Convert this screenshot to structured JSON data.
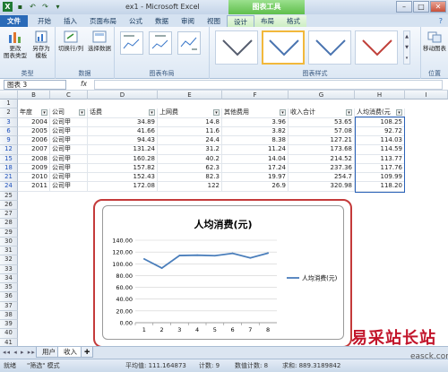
{
  "titlebar": {
    "title": "ex1 - Microsoft Excel",
    "context_group": "图表工具"
  },
  "tabs": [
    "文件",
    "开始",
    "插入",
    "页面布局",
    "公式",
    "数据",
    "审阅",
    "视图",
    "设计",
    "布局",
    "格式"
  ],
  "ribbon": {
    "groups": {
      "type": "类型",
      "data": "数据",
      "layouts": "图表布局",
      "styles": "图表样式",
      "location": "位置"
    },
    "buttons": {
      "change_type": "更改\n图表类型",
      "save_template": "另存为\n模板",
      "switch_rowcol": "切换行/列",
      "select_data": "选择数据",
      "move_chart": "移动图表"
    },
    "style_colors": [
      "#555d6e",
      "#4a74b0",
      "#4a74b0",
      "#c0403a",
      "#999999"
    ]
  },
  "formula_bar": {
    "name_box": "图表 3",
    "fx": "fx"
  },
  "columns": [
    "B",
    "C",
    "D",
    "E",
    "F",
    "G",
    "H",
    "I"
  ],
  "row_numbers": [
    "1",
    "2",
    "3",
    "6",
    "9",
    "12",
    "15",
    "18",
    "21",
    "24",
    "25",
    "26",
    "27",
    "28",
    "29",
    "30",
    "31",
    "32",
    "33",
    "34",
    "35",
    "36",
    "37",
    "38",
    "39",
    "40",
    "41"
  ],
  "headers": [
    "年度",
    "公司",
    "话费",
    "上网费",
    "其他费用",
    "收入合计",
    "人均消费(元"
  ],
  "rows": [
    {
      "year": "2004",
      "company": "公司甲",
      "phone": "34.89",
      "internet": "14.8",
      "other": "3.96",
      "income": "53.65",
      "per_capita": "108.25"
    },
    {
      "year": "2005",
      "company": "公司甲",
      "phone": "41.66",
      "internet": "11.6",
      "other": "3.82",
      "income": "57.08",
      "per_capita": "92.72"
    },
    {
      "year": "2006",
      "company": "公司甲",
      "phone": "94.43",
      "internet": "24.4",
      "other": "8.38",
      "income": "127.21",
      "per_capita": "114.03"
    },
    {
      "year": "2007",
      "company": "公司甲",
      "phone": "131.24",
      "internet": "31.2",
      "other": "11.24",
      "income": "173.68",
      "per_capita": "114.59"
    },
    {
      "year": "2008",
      "company": "公司甲",
      "phone": "160.28",
      "internet": "40.2",
      "other": "14.04",
      "income": "214.52",
      "per_capita": "113.77"
    },
    {
      "year": "2009",
      "company": "公司甲",
      "phone": "157.82",
      "internet": "62.3",
      "other": "17.24",
      "income": "237.36",
      "per_capita": "117.76"
    },
    {
      "year": "2010",
      "company": "公司甲",
      "phone": "152.43",
      "internet": "82.3",
      "other": "19.97",
      "income": "254.7",
      "per_capita": "109.99"
    },
    {
      "year": "2011",
      "company": "公司甲",
      "phone": "172.08",
      "internet": "122",
      "other": "26.9",
      "income": "320.98",
      "per_capita": "118.20"
    }
  ],
  "chart_data": {
    "type": "line",
    "title": "人均消费(元)",
    "categories": [
      "1",
      "2",
      "3",
      "4",
      "5",
      "6",
      "7",
      "8"
    ],
    "series": [
      {
        "name": "人均消费(元)",
        "values": [
          108.25,
          92.72,
          114.03,
          114.59,
          113.77,
          117.76,
          109.99,
          118.2
        ],
        "color": "#4a7ebb"
      }
    ],
    "yticks": [
      "0.00",
      "20.00",
      "40.00",
      "60.00",
      "80.00",
      "100.00",
      "120.00",
      "140.00"
    ],
    "ylim": [
      0,
      140
    ],
    "grid": true,
    "legend": "right"
  },
  "sheet_tabs": {
    "nav": "◂◂ ◂ ▸ ▸▸",
    "items": [
      "用户",
      "收入"
    ]
  },
  "status": {
    "mode": "就绪",
    "filter": "\"筛选\" 模式",
    "average": "平均值: 111.164873",
    "count": "计数: 9",
    "numeric_count": "数值计数: 8",
    "sum": "求和: 889.3189842"
  },
  "watermark": {
    "text": "易采站长站",
    "url": "easck.com"
  }
}
